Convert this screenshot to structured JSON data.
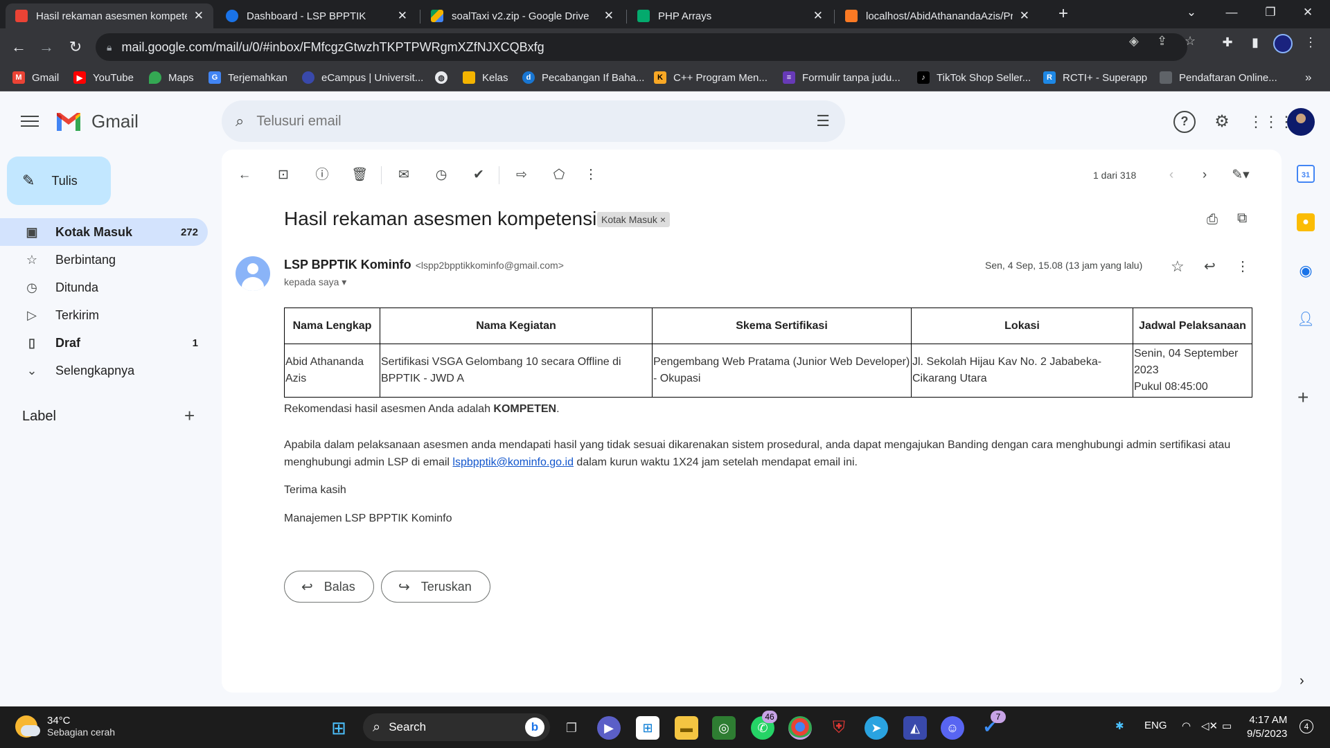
{
  "browser": {
    "tabs": [
      {
        "title": "Hasil rekaman asesmen kompete",
        "favicon": "gmail-icon",
        "active": true
      },
      {
        "title": "Dashboard - LSP BPPTIK",
        "favicon": "lsp-icon",
        "active": false
      },
      {
        "title": "soalTaxi v2.zip - Google Drive",
        "favicon": "drive-icon",
        "active": false
      },
      {
        "title": "PHP Arrays",
        "favicon": "w3schools-icon",
        "active": false
      },
      {
        "title": "localhost/AbidAthanandaAzis/Pr",
        "favicon": "xampp-icon",
        "active": false
      }
    ],
    "url": "mail.google.com/mail/u/0/#inbox/FMfcgzGtwzhTKPTPWRgmXZfNJXCQBxfg",
    "bookmarks": [
      {
        "label": "Gmail",
        "icon": "gmail-icon",
        "color": "#ea4335"
      },
      {
        "label": "YouTube",
        "icon": "youtube-icon",
        "color": "#ff0000"
      },
      {
        "label": "Maps",
        "icon": "maps-icon",
        "color": "#34a853"
      },
      {
        "label": "Terjemahkan",
        "icon": "translate-icon",
        "color": "#4285f4"
      },
      {
        "label": "eCampus | Universit...",
        "icon": "ecampus-icon",
        "color": "#3949ab"
      },
      {
        "label": "",
        "icon": "globe-icon",
        "color": "#9aa0a6"
      },
      {
        "label": "Kelas",
        "icon": "classroom-icon",
        "color": "#f4b400"
      },
      {
        "label": "Pecabangan If Baha...",
        "icon": "site-icon",
        "color": "#1976d2"
      },
      {
        "label": "C++ Program Men...",
        "icon": "site-k-icon",
        "color": "#f9a825"
      },
      {
        "label": "Formulir tanpa judu...",
        "icon": "forms-icon",
        "color": "#673ab7"
      },
      {
        "label": "TikTok Shop Seller...",
        "icon": "tiktok-icon",
        "color": "#000000"
      },
      {
        "label": "RCTI+ - Superapp",
        "icon": "rcti-icon",
        "color": "#1e88e5"
      },
      {
        "label": "Pendaftaran Online...",
        "icon": "folder-icon",
        "color": "#5f6368"
      }
    ]
  },
  "gmail": {
    "brand": "Gmail",
    "search_placeholder": "Telusuri email",
    "compose_label": "Tulis",
    "nav": [
      {
        "label": "Kotak Masuk",
        "count": "272",
        "icon": "inbox-icon"
      },
      {
        "label": "Berbintang",
        "count": "",
        "icon": "star-icon"
      },
      {
        "label": "Ditunda",
        "count": "",
        "icon": "clock-icon"
      },
      {
        "label": "Terkirim",
        "count": "",
        "icon": "send-icon"
      },
      {
        "label": "Draf",
        "count": "1",
        "icon": "draft-icon"
      },
      {
        "label": "Selengkapnya",
        "count": "",
        "icon": "chevron-down-icon"
      }
    ],
    "labels_header": "Label",
    "pager": "1 dari 318"
  },
  "email": {
    "subject": "Hasil rekaman asesmen kompetensi",
    "chip": "Kotak Masuk",
    "sender_name": "LSP BPPTIK Kominfo",
    "sender_email": "<lspp2bpptikkominfo@gmail.com>",
    "to": "kepada saya",
    "date": "Sen, 4 Sep, 15.08 (13 jam yang lalu)",
    "table": {
      "headers": [
        "Nama Lengkap",
        "Nama Kegiatan",
        "Skema Sertifikasi",
        "Lokasi",
        "Jadwal Pelaksanaan"
      ],
      "row": [
        "Abid Athananda Azis",
        "Sertifikasi VSGA Gelombang 10 secara Offline di BPPTIK - JWD A",
        "Pengembang Web Pratama (Junior Web Developer) - Okupasi",
        "Jl. Sekolah Hijau Kav No. 2 Jababeka-Cikarang Utara",
        "Senin, 04 September 2023"
      ],
      "schedule_time": "Pukul 08:45:00"
    },
    "recommendation_prefix": "Rekomendasi hasil asesmen Anda adalah ",
    "recommendation_result": "KOMPETEN",
    "recommendation_suffix": ".",
    "appeal_text_1": "Apabila dalam pelaksanaan asesmen anda mendapati hasil yang tidak sesuai dikarenakan sistem prosedural, anda dapat mengajukan Banding dengan cara menghubungi admin sertifikasi atau menghubungi admin LSP di email ",
    "appeal_email": "lspbpptik@kominfo.go.id",
    "appeal_text_2": " dalam kurun waktu 1X24 jam setelah mendapat email ini.",
    "thanks": "Terima kasih",
    "signature": "Manajemen LSP BPPTIK Kominfo",
    "reply_label": "Balas",
    "forward_label": "Teruskan"
  },
  "taskbar": {
    "temperature": "34°C",
    "weather": "Sebagian cerah",
    "search_label": "Search",
    "whatsapp_badge": "46",
    "todo_badge": "7",
    "language": "ENG",
    "time": "4:17 AM",
    "date": "9/5/2023",
    "notifications": "4"
  },
  "colors": {
    "accent": "#0b57d0",
    "nav_active": "#d3e3fd",
    "compose": "#c2e7ff",
    "link": "#1155cc"
  }
}
